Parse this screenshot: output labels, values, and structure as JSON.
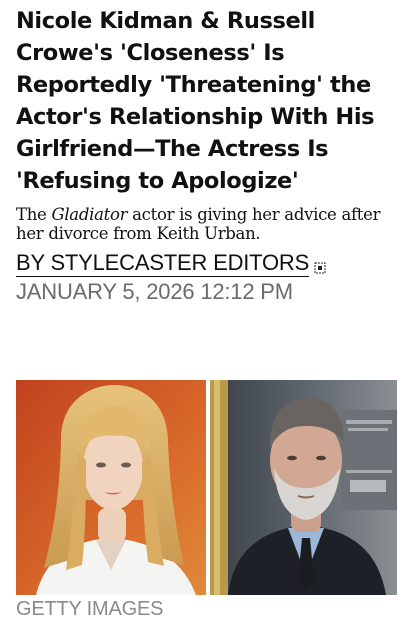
{
  "article": {
    "headline": "Nicole Kidman & Russell Crowe's 'Closeness' Is Reportedly 'Threatening' the Actor's Relationship With His Girlfriend—The Actress Is 'Refusing to Apologize'",
    "dek_prefix": "The ",
    "dek_italic": "Gladiator",
    "dek_suffix": " actor is giving her advice after her divorce from Keith Urban.",
    "byline": "BY STYLECASTER EDITORS",
    "date": "JANUARY 5, 2026 12:12 PM",
    "image_credit": "GETTY IMAGES"
  },
  "icons": {
    "byline_link": "external-link-icon"
  },
  "colors": {
    "text": "#111111",
    "date": "#6b6b6b",
    "credit": "#8a8a8a"
  }
}
